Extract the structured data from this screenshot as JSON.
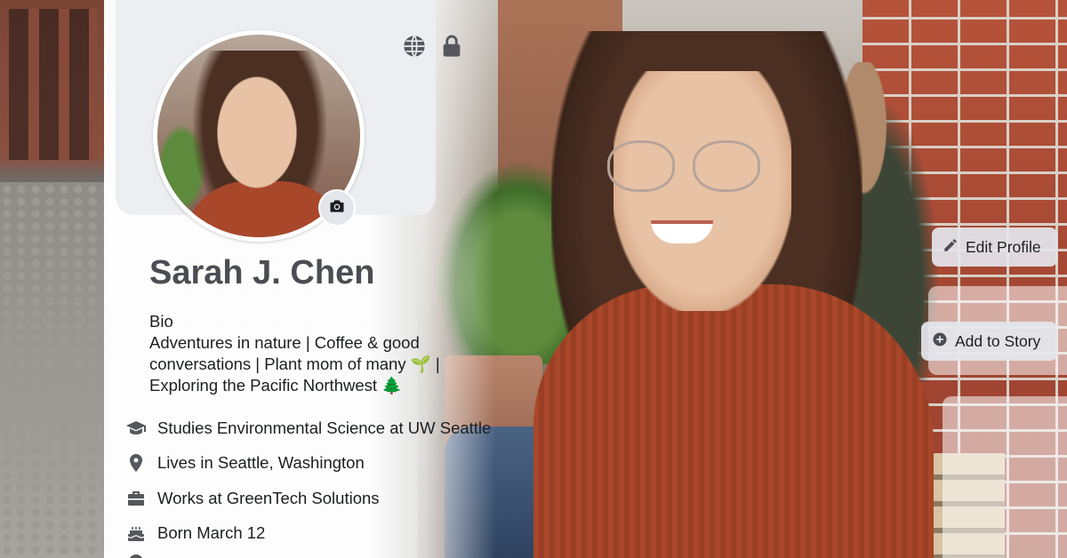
{
  "profile": {
    "name": "Sarah J. Chen",
    "bio_title": "Bio",
    "bio_lines": [
      "Adventures in nature | Coffee & good",
      "conversations | Plant mom of many 🌱 |",
      "Exploring the Pacific Northwest 🌲"
    ],
    "details": [
      {
        "icon": "graduation-cap-icon",
        "text": "Studies Environmental Science at UW Seattle"
      },
      {
        "icon": "location-pin-icon",
        "text": "Lives in Seattle, Washington"
      },
      {
        "icon": "briefcase-icon",
        "text": "Works at GreenTech Solutions"
      },
      {
        "icon": "birthday-cake-icon",
        "text": "Born March 12"
      }
    ]
  },
  "header_icons": [
    "globe-icon",
    "lock-icon"
  ],
  "actions": {
    "edit_profile": "Edit Profile",
    "add_to_story": "Add to Story"
  },
  "colors": {
    "card_bg": "#ffffff",
    "header_bg": "#eceef1",
    "name_color": "#4b4d52",
    "button_bg": "#e4e6eb",
    "sweater": "#a8472a",
    "brick": "#a24632"
  }
}
